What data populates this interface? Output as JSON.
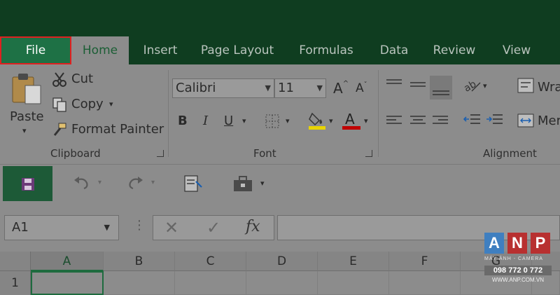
{
  "tabs": [
    {
      "label": "File",
      "highlighted": true
    },
    {
      "label": "Home",
      "active": true
    },
    {
      "label": "Insert"
    },
    {
      "label": "Page Layout"
    },
    {
      "label": "Formulas"
    },
    {
      "label": "Data"
    },
    {
      "label": "Review"
    },
    {
      "label": "View"
    }
  ],
  "clipboard": {
    "paste": "Paste",
    "cut": "Cut",
    "copy": "Copy",
    "format_painter": "Format Painter",
    "group_label": "Clipboard"
  },
  "font": {
    "name": "Calibri",
    "size": "11",
    "bold": "B",
    "italic": "I",
    "underline": "U",
    "group_label": "Font",
    "highlight_color": "#e8d400",
    "font_color": "#c00000"
  },
  "alignment": {
    "wrap": "Wra",
    "merge": "Mer",
    "group_label": "Alignment"
  },
  "formula_bar": {
    "name_box": "A1",
    "fx": "fx"
  },
  "grid": {
    "columns": [
      "A",
      "B",
      "C",
      "D",
      "E",
      "F",
      "G"
    ],
    "rows": [
      "1"
    ]
  },
  "watermark": {
    "letters": [
      "A",
      "N",
      "P"
    ],
    "tagline": "MÁY ẢNH - CAMERA",
    "phone": "098 772 0 772",
    "url": "WWW.ANP.COM.VN"
  },
  "colors": {
    "excel_green": "#1e7145",
    "title_bar": "#0f3d20",
    "highlight_border": "#e02020"
  }
}
